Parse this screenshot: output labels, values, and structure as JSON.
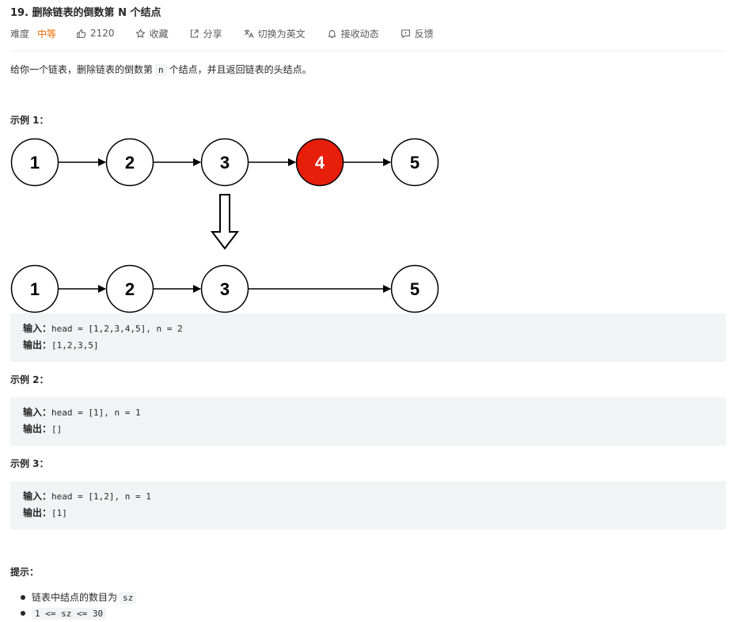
{
  "problem": {
    "title": "19. 删除链表的倒数第 N 个结点"
  },
  "meta": {
    "difficulty_label": "难度",
    "difficulty_value": "中等",
    "likes": "2120",
    "favorite": "收藏",
    "share": "分享",
    "switch_language": "切换为英文",
    "notify": "接收动态",
    "feedback": "反馈"
  },
  "description": {
    "prefix": "给你一个链表，删除链表的倒数第",
    "code": "n",
    "suffix": "个结点，并且返回链表的头结点。"
  },
  "diagram": {
    "top_row": [
      "1",
      "2",
      "3",
      "4",
      "5"
    ],
    "bottom_row": [
      "1",
      "2",
      "3",
      "5"
    ],
    "removed_value": "4",
    "removed_color": "#e61e0a"
  },
  "examples": [
    {
      "title": "示例 1：",
      "input_label": "输入：",
      "input": "head = [1,2,3,4,5], n = 2",
      "output_label": "输出：",
      "output": "[1,2,3,5]"
    },
    {
      "title": "示例 2：",
      "input_label": "输入：",
      "input": "head = [1], n = 1",
      "output_label": "输出：",
      "output": "[]"
    },
    {
      "title": "示例 3：",
      "input_label": "输入：",
      "input": "head = [1,2], n = 1",
      "output_label": "输出：",
      "output": "[1]"
    }
  ],
  "hints": {
    "title": "提示：",
    "item1_text": "链表中结点的数目为",
    "item1_code": "sz",
    "item2_code": "1 <= sz <= 30"
  },
  "colors": {
    "difficulty": "#ef6c00",
    "code_background": "#f2f3f4"
  }
}
